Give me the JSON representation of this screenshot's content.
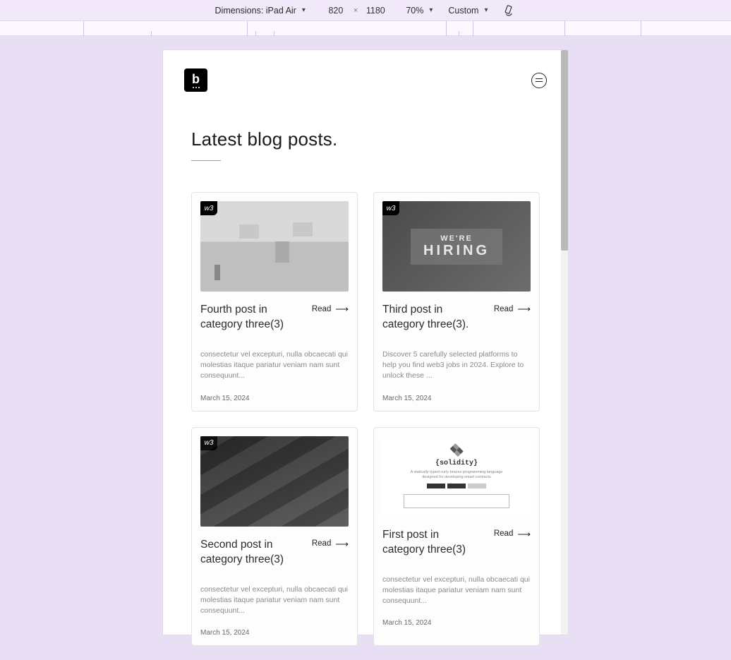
{
  "toolbar": {
    "device_label": "Dimensions: iPad Air",
    "width": "820",
    "height": "1180",
    "zoom": "70%",
    "throttle": "Custom"
  },
  "header": {
    "logo_letter": "b"
  },
  "page": {
    "title": "Latest blog posts."
  },
  "posts": [
    {
      "badge": "w3",
      "title": "Fourth post in category three(3)",
      "read": "Read",
      "excerpt": "consectetur vel excepturi, nulla obcaecati qui molestias itaque pariatur veniam nam sunt consequunt...",
      "date": "March 15, 2024"
    },
    {
      "badge": "w3",
      "title": "Third post in category three(3).",
      "read": "Read",
      "excerpt": "Discover 5 carefully selected platforms to help you find web3 jobs in 2024. Explore to unlock these ...",
      "date": "March 15, 2024",
      "hiring_small": "WE'RE",
      "hiring_big": "HIRING"
    },
    {
      "badge": "w3",
      "title": "Second post in category three(3)",
      "read": "Read",
      "excerpt": "consectetur vel excepturi, nulla obcaecati qui molestias itaque pariatur veniam nam sunt consequunt...",
      "date": "March 15, 2024"
    },
    {
      "badge": "w3",
      "title": "First post in category three(3)",
      "read": "Read",
      "excerpt": "consectetur vel excepturi, nulla obcaecati qui molestias itaque pariatur veniam nam sunt consequunt...",
      "date": "March 15, 2024",
      "solidity_label": "{solidity}"
    }
  ]
}
